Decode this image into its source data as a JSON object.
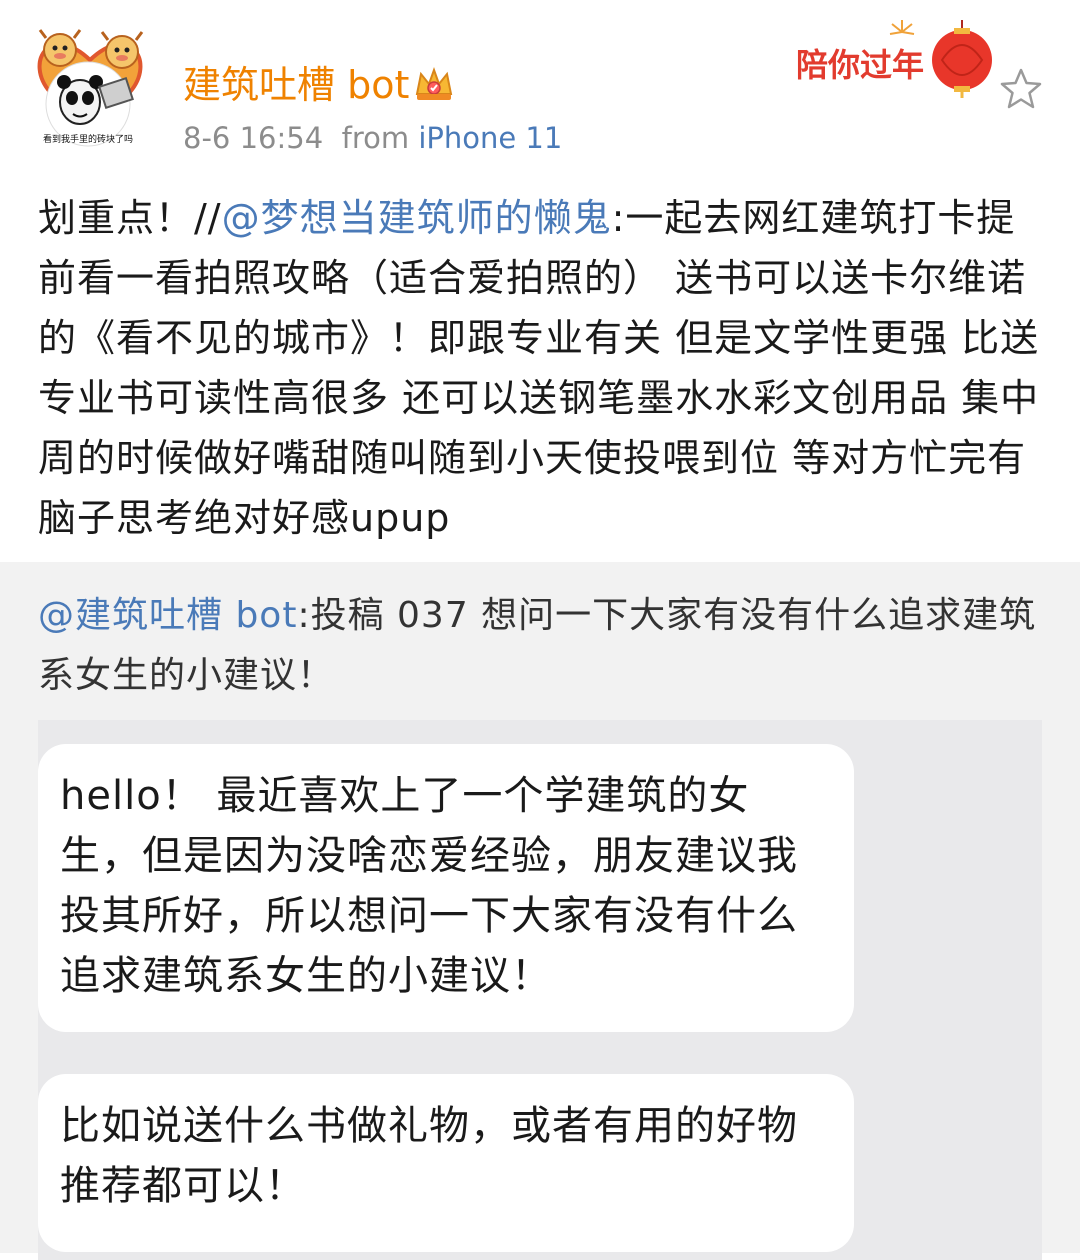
{
  "post": {
    "username": "建筑吐槽 bot",
    "timestamp": "8-6 16:54",
    "from_label": "from",
    "device": "iPhone 11",
    "avatar_caption": "看到我手里的砖块了吗",
    "badge_text": "陪你过年",
    "text_prefix": "划重点！//",
    "text_mention": "@梦想当建筑师的懒鬼",
    "text_body": ":一起去网红建筑打卡提前看一看拍照攻略（适合爱拍照的） 送书可以送卡尔维诺的《看不见的城市》！即跟专业有关 但是文学性更强 比送专业书可读性高很多 还可以送钢笔墨水水彩文创用品 集中周的时候做好嘴甜随叫随到小天使投喂到位 等对方忙完有脑子思考绝对好感upup",
    "icons": {
      "verified": "crown-icon",
      "favorite": "star-icon"
    },
    "colors": {
      "username": "#ef8200",
      "link": "#4a7ab8",
      "badge": "#e23b2e"
    }
  },
  "repost": {
    "mention": "@建筑吐槽 bot",
    "body": ":投稿 037 想问一下大家有没有什么追求建筑系女生的小建议！",
    "bubbles": [
      "hello！ 最近喜欢上了一个学建筑的女生，但是因为没啥恋爱经验，朋友建议我投其所好，所以想问一下大家有没有什么追求建筑系女生的小建议！",
      "比如说送什么书做礼物，或者有用的好物推荐都可以！"
    ]
  }
}
